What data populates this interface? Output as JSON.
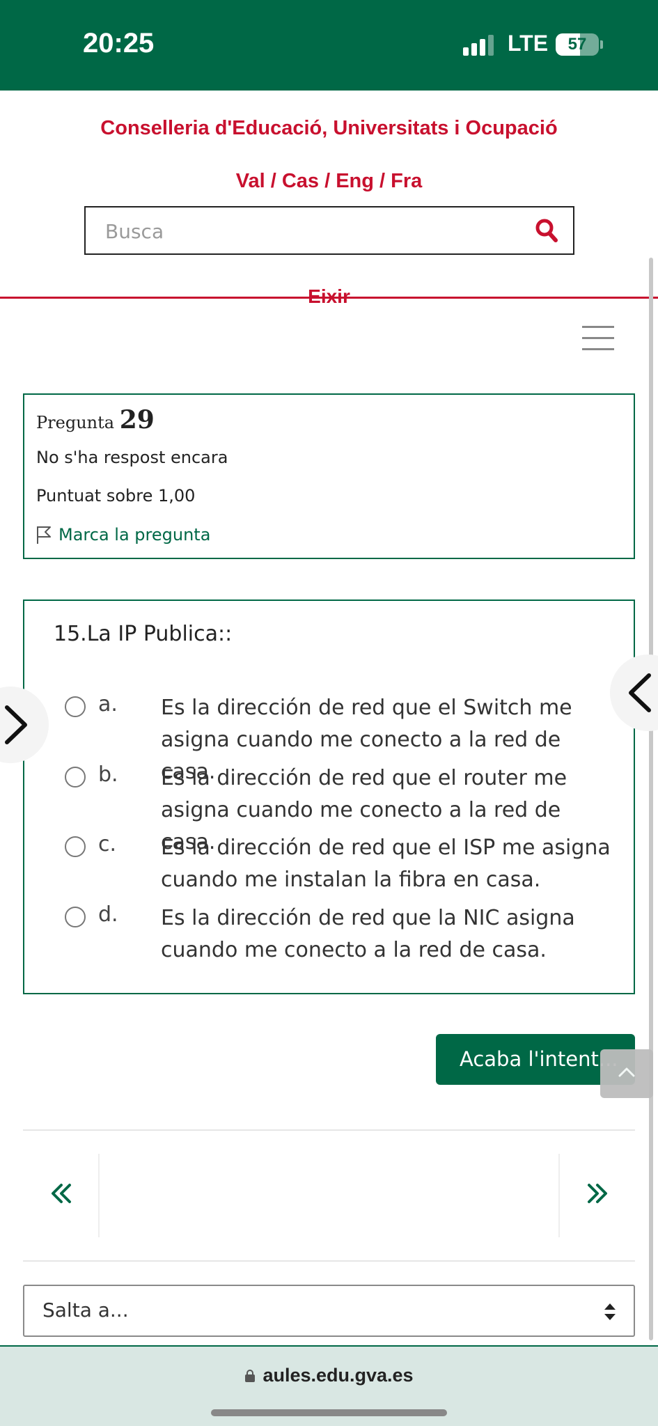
{
  "status_bar": {
    "time": "20:25",
    "network": "LTE",
    "battery_level": "57"
  },
  "header": {
    "ministry": "Conselleria d'Educació, Universitats i Ocupació",
    "languages": "Val / Cas / Eng / Fra",
    "search_placeholder": "Busca",
    "logout": "Eixir"
  },
  "question_info": {
    "label": "Pregunta",
    "number": "29",
    "state": "No s'ha respost encara",
    "grade": "Puntuat sobre 1,00",
    "flag_label": "Marca la pregunta"
  },
  "question": {
    "text": "15.La IP Publica::",
    "answers": [
      {
        "letter": "a.",
        "text": "Es la dirección de red que el Switch me asigna cuando me conecto a la red de casa.",
        "selected": false
      },
      {
        "letter": "b.",
        "text": "Es la dirección de red que el router me asigna cuando me conecto a la red de casa.",
        "selected": false
      },
      {
        "letter": "c.",
        "text": "Es la dirección de red que el ISP me asigna cuando me instalan la fibra en casa.",
        "selected": false
      },
      {
        "letter": "d.",
        "text": "Es la dirección de red que la NIC asigna cuando me conecto a la red de casa.",
        "selected": false
      }
    ]
  },
  "actions": {
    "finish_label": "Acaba l'intent..."
  },
  "navigation": {
    "prev_symbol": "«",
    "next_symbol": "»",
    "jump_label": "Salta a..."
  },
  "browser": {
    "url": "aules.edu.gva.es"
  },
  "colors": {
    "brand_green": "#006846",
    "accent_red": "#c8102e"
  }
}
